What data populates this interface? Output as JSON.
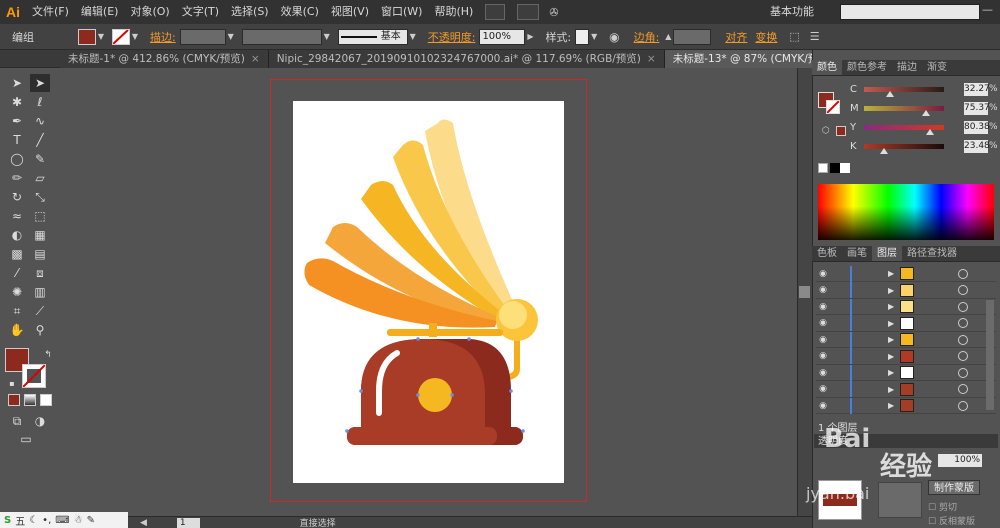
{
  "app": {
    "logo": "Ai"
  },
  "menu": [
    "文件(F)",
    "编辑(E)",
    "对象(O)",
    "文字(T)",
    "选择(S)",
    "效果(C)",
    "视图(V)",
    "窗口(W)",
    "帮助(H)"
  ],
  "workspace": "基本功能",
  "controlbar": {
    "group_label": "编组",
    "stroke_label": "描边:",
    "brush_label": "基本",
    "opacity_label": "不透明度:",
    "opacity_value": "100%",
    "style_label": "样式:",
    "corner_label": "边角:",
    "align_label": "对齐",
    "transform_label": "变换"
  },
  "tabs": [
    {
      "label": "未标题-1* @ 412.86% (CMYK/预览)",
      "active": false
    },
    {
      "label": "Nipic_29842067_20190910102324767000.ai* @ 117.69% (RGB/预览)",
      "active": false
    },
    {
      "label": "未标题-13* @ 87% (CMYK/预览)",
      "active": true
    }
  ],
  "color_panel": {
    "tabs": [
      "颜色",
      "颜色参考",
      "描边",
      "渐变"
    ],
    "channels": [
      {
        "label": "C",
        "value": "32.27",
        "pos": 0.32
      },
      {
        "label": "M",
        "value": "75.37",
        "pos": 0.75
      },
      {
        "label": "Y",
        "value": "80.38",
        "pos": 0.8
      },
      {
        "label": "K",
        "value": "23.48",
        "pos": 0.23
      }
    ],
    "fill_color": "#8b2a1d"
  },
  "layers_panel": {
    "tabs": [
      "色板",
      "画笔",
      "图层",
      "路径查找器"
    ],
    "footer": "1 个图层",
    "rows": [
      "#f5b820",
      "#fbd26a",
      "#fbe08a",
      "#ffffff",
      "#f5b820",
      "#b03a26",
      "#ffffff",
      "#a33d25",
      "#a33d25"
    ]
  },
  "bottom_panel": {
    "title": "透明度",
    "value": "100%",
    "make_mask": "制作蒙版",
    "clip": "剪切",
    "invert": "反相蒙版"
  },
  "status": {
    "zoom": "87%",
    "page": "1",
    "tool": "直接选择"
  },
  "watermark": {
    "top": "Bai",
    "middle": "经验",
    "bottom": "jyan.bai"
  }
}
